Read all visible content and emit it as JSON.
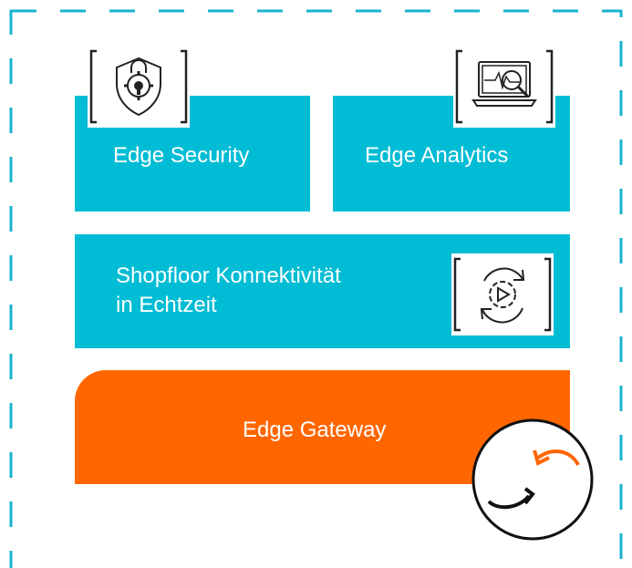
{
  "colors": {
    "teal": "#00bcd4",
    "orange": "#ff6600",
    "frame": "#1ab3cf",
    "ink": "#222222"
  },
  "cards": {
    "edge_security": {
      "label": "Edge Security",
      "icon": "shield-lock-gear-icon"
    },
    "edge_analytics": {
      "label": "Edge Analytics",
      "icon": "laptop-analytics-icon"
    },
    "shopfloor": {
      "line1": "Shopfloor Konnektivität",
      "line2": "in Echtzeit",
      "icon": "play-gear-cycle-icon"
    },
    "gateway": {
      "label": "Edge Gateway",
      "icon": "exchange-arrows-icon"
    }
  }
}
